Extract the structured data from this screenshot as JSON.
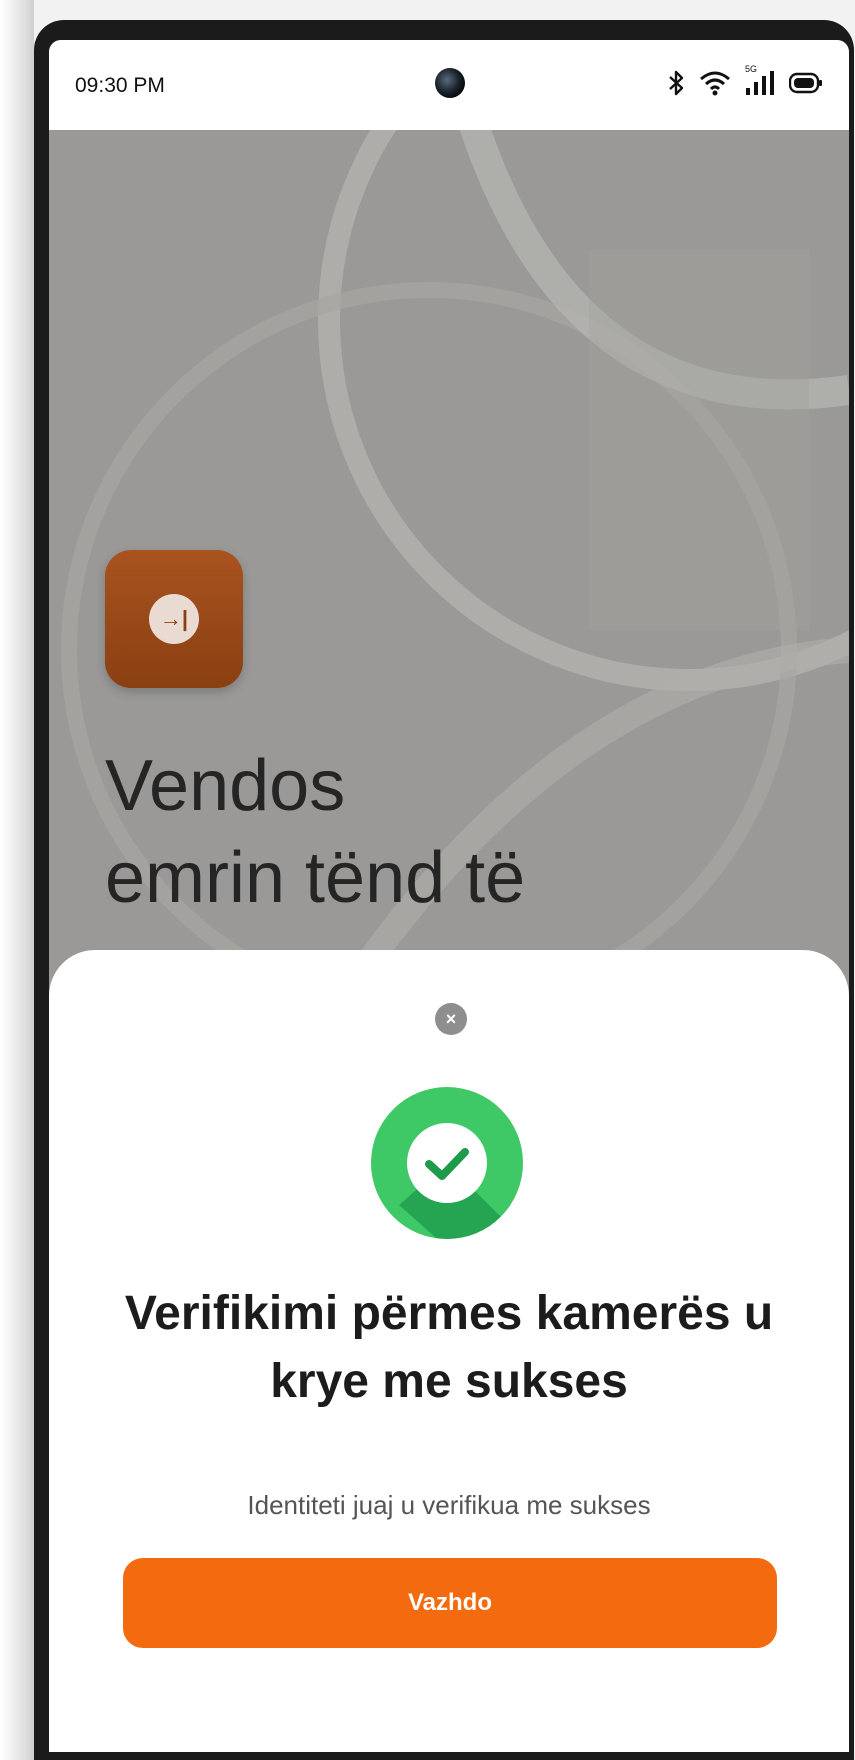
{
  "status_bar": {
    "time": "09:30 PM",
    "network_label": "5G"
  },
  "background_screen": {
    "app_icon_glyph": "→|",
    "title": "Vendos\nemrin tënd të"
  },
  "dialog": {
    "close_glyph": "×",
    "title": "Verifikimi përmes kamerës u krye me sukses",
    "subtitle": "Identiteti juaj u verifikua me sukses",
    "primary_button": "Vazhdo"
  },
  "colors": {
    "accent": "#f46a0e",
    "success": "#2fbf5b",
    "app_tile": "#8a3f12"
  },
  "icons": [
    "bluetooth-icon",
    "wifi-icon",
    "signal-icon",
    "battery-icon",
    "camera-icon",
    "login-arrow-icon",
    "close-icon",
    "success-check-icon"
  ]
}
